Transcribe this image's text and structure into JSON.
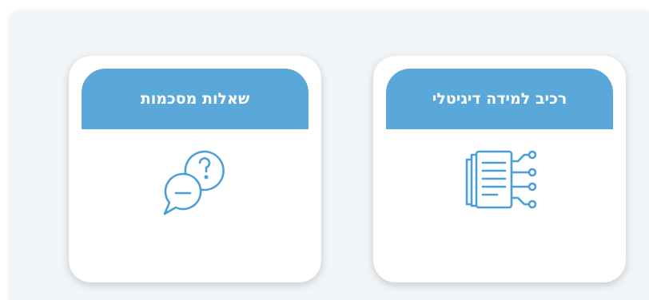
{
  "colors": {
    "accent": "#5aa7d9",
    "icon_stroke": "#4a9fd8",
    "panel_bg": "#f2f5f8"
  },
  "cards": [
    {
      "title": "רכיב למידה דיגיטלי",
      "icon": "digital-document-icon"
    },
    {
      "title": "שאלות מסכמות",
      "icon": "chat-question-icon"
    }
  ]
}
